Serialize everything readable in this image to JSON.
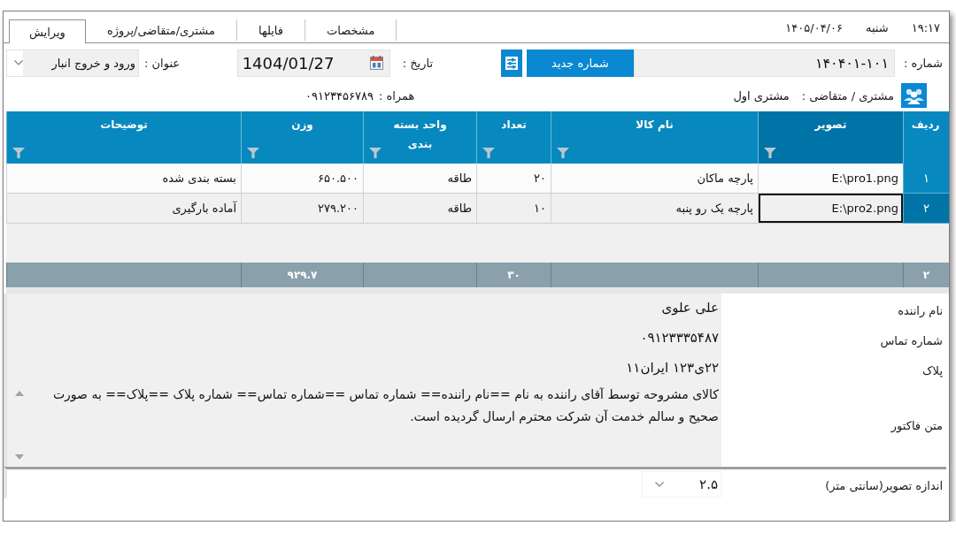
{
  "top_bar": {
    "time": "۱۹:۱۷",
    "weekday": "شنبه",
    "date": "۱۴۰۵/۰۴/۰۶"
  },
  "tabs": [
    {
      "label": "مشخصات",
      "selected": false
    },
    {
      "label": "فایلها",
      "selected": false
    },
    {
      "label": "مشتری/متقاضی/پروژه",
      "selected": false
    },
    {
      "label": "ویرایش",
      "selected": true
    }
  ],
  "form": {
    "number": {
      "label": "شماره :",
      "value": "۱۴۰۴۰۱-۱۰۱",
      "button": "شماره جدید"
    },
    "date": {
      "label": "تاریخ :",
      "value": "1404/01/27"
    },
    "title": {
      "label": "عنوان :",
      "value": "ورود و خروج انبار"
    },
    "customer": {
      "label": "مشتری / متقاضی :",
      "value": "مشتری اول"
    },
    "mobile": {
      "label": "همراه :",
      "value": "۰۹۱۲۳۴۵۶۷۸۹"
    }
  },
  "table": {
    "columns": [
      {
        "label": "ردیف",
        "filter": false,
        "selected": false,
        "total": "۲"
      },
      {
        "label": "تصویر",
        "filter": true,
        "selected": true
      },
      {
        "label": "نام کالا",
        "filter": true,
        "selected": false
      },
      {
        "label": "تعداد",
        "filter": true,
        "selected": false,
        "total": "۳۰"
      },
      {
        "label": "واحد بسته بندی",
        "filter": true,
        "selected": false
      },
      {
        "label": "وزن",
        "filter": true,
        "selected": false,
        "total": "۹۲۹.۷"
      },
      {
        "label": "توضیحات",
        "filter": true,
        "selected": false
      }
    ],
    "rows": [
      {
        "selected": false,
        "cells": [
          "۱",
          "E:\\pro1.png",
          "پارچه ماکان",
          "۲۰",
          "طاقه",
          "۶۵۰.۵۰۰",
          "بسته بندی شده"
        ]
      },
      {
        "selected": true,
        "cells": [
          "۲",
          "E:\\pro2.png",
          "پارچه یک رو پنبه",
          "۱۰",
          "طاقه",
          "۲۷۹.۲۰۰",
          "آماده بارگیری"
        ]
      }
    ]
  },
  "details": [
    {
      "kind": "text",
      "label": "نام راننده",
      "value": "علی علوی"
    },
    {
      "kind": "text",
      "label": "شماره تماس",
      "value": "۰۹۱۲۳۳۳۵۴۸۷"
    },
    {
      "kind": "text",
      "label": "پلاک",
      "value": "۲۲ی۱۲۳ ایران۱۱"
    },
    {
      "kind": "textarea",
      "label": "متن فاکتور",
      "value": "کالای مشروحه توسط آقای راننده به نام ==نام راننده== شماره تماس ==شماره تماس== شماره پلاک ==پلاک== به صورت صحیح و سالم خدمت آن شرکت محترم ارسال گردیده است."
    }
  ],
  "image_size": {
    "label": "اندازه تصویر(سانتی متر)",
    "value": "۲.۵"
  }
}
